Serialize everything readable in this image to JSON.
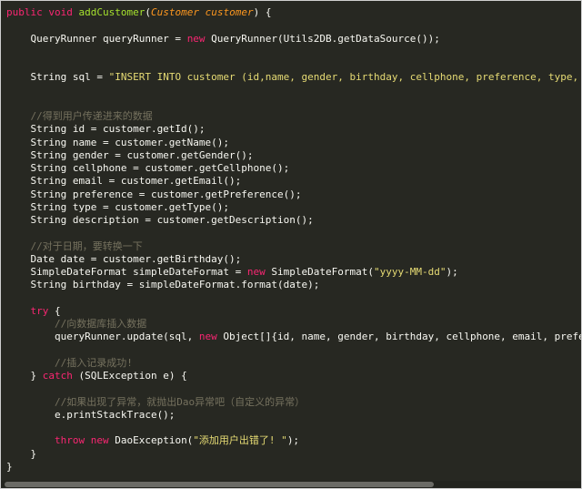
{
  "code_lines": [
    [
      [
        "kw",
        "public"
      ],
      [
        "",
        ""
      ],
      [
        "kw",
        " void "
      ],
      [
        "fn",
        "addCustomer"
      ],
      [
        "",
        "("
      ],
      [
        "pa",
        "Customer customer"
      ],
      [
        "",
        ") {"
      ]
    ],
    [],
    [
      [
        "",
        "    QueryRunner queryRunner = "
      ],
      [
        "kw",
        "new"
      ],
      [
        "",
        " QueryRunner(Utils2DB.getDataSource());"
      ]
    ],
    [],
    [],
    [
      [
        "",
        "    String sql = "
      ],
      [
        "st",
        "\"INSERT INTO customer (id,name, gender, birthday, cellphone, preference, type, descriptio"
      ]
    ],
    [],
    [],
    [
      [
        "cm",
        "    //得到用户传递进来的数据"
      ]
    ],
    [
      [
        "",
        "    String id = customer.getId();"
      ]
    ],
    [
      [
        "",
        "    String name = customer.getName();"
      ]
    ],
    [
      [
        "",
        "    String gender = customer.getGender();"
      ]
    ],
    [
      [
        "",
        "    String cellphone = customer.getCellphone();"
      ]
    ],
    [
      [
        "",
        "    String email = customer.getEmail();"
      ]
    ],
    [
      [
        "",
        "    String preference = customer.getPreference();"
      ]
    ],
    [
      [
        "",
        "    String type = customer.getType();"
      ]
    ],
    [
      [
        "",
        "    String description = customer.getDescription();"
      ]
    ],
    [],
    [
      [
        "cm",
        "    //对于日期，要转换一下"
      ]
    ],
    [
      [
        "",
        "    Date date = customer.getBirthday();"
      ]
    ],
    [
      [
        "",
        "    SimpleDateFormat simpleDateFormat = "
      ],
      [
        "kw",
        "new"
      ],
      [
        "",
        " SimpleDateFormat("
      ],
      [
        "st",
        "\"yyyy-MM-dd\""
      ],
      [
        "",
        ");"
      ]
    ],
    [
      [
        "",
        "    String birthday = simpleDateFormat.format(date);"
      ]
    ],
    [],
    [
      [
        "kw",
        "    try"
      ],
      [
        "",
        " {"
      ]
    ],
    [
      [
        "cm",
        "        //向数据库插入数据"
      ]
    ],
    [
      [
        "",
        "        queryRunner.update(sql, "
      ],
      [
        "kw",
        "new"
      ],
      [
        "",
        " Object[]{id, name, gender, birthday, cellphone, email, preference, type"
      ]
    ],
    [],
    [
      [
        "cm",
        "        //插入记录成功!"
      ]
    ],
    [
      [
        "",
        "    } "
      ],
      [
        "kw",
        "catch"
      ],
      [
        "",
        " (SQLException e) {"
      ]
    ],
    [],
    [
      [
        "cm",
        "        //如果出现了异常，就抛出Dao异常吧（自定义的异常）"
      ]
    ],
    [
      [
        "",
        "        e.printStackTrace();"
      ]
    ],
    [],
    [
      [
        "kw",
        "        throw new"
      ],
      [
        "",
        " DaoException("
      ],
      [
        "st",
        "\"添加用户出错了! \""
      ],
      [
        "",
        ");"
      ]
    ],
    [
      [
        "",
        "    }"
      ]
    ],
    [
      [
        "",
        "}"
      ]
    ]
  ]
}
